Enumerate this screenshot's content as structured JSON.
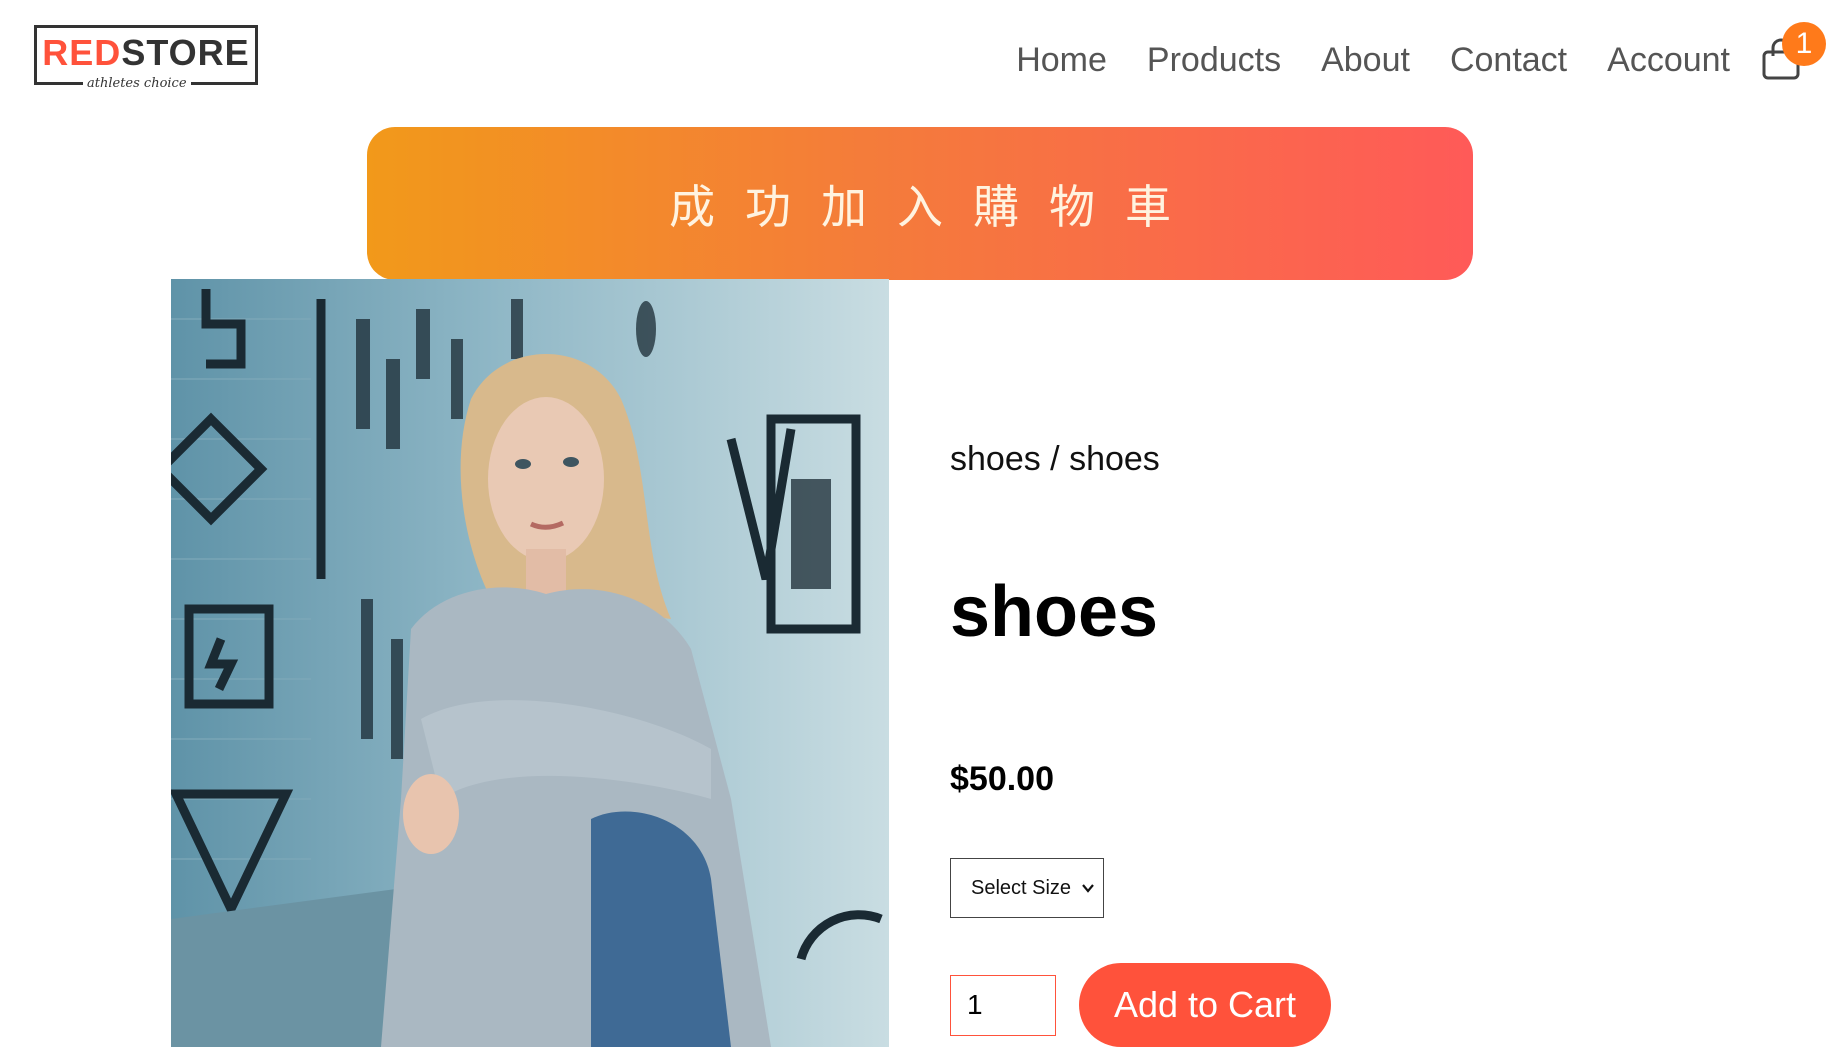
{
  "header": {
    "logo": {
      "brand_red": "RED",
      "brand_dark": "STORE",
      "tagline": "athletes choice"
    },
    "nav": [
      {
        "label": "Home"
      },
      {
        "label": "Products"
      },
      {
        "label": "About"
      },
      {
        "label": "Contact"
      },
      {
        "label": "Account"
      }
    ],
    "cart": {
      "icon": "shopping-bag-icon",
      "count": "1"
    }
  },
  "toast": {
    "message": "成功加入購物車"
  },
  "product": {
    "image_alt": "woman-in-grey-sweater-photo",
    "breadcrumb": "shoes / shoes",
    "title": "shoes",
    "price": "$50.00",
    "size_select": {
      "selected": "Select Size"
    },
    "quantity": "1",
    "add_to_cart_label": "Add to Cart"
  },
  "colors": {
    "accent": "#ff523b",
    "badge": "#ff7a1a",
    "toast_start": "#f2991a",
    "toast_end": "#ff5a58"
  }
}
